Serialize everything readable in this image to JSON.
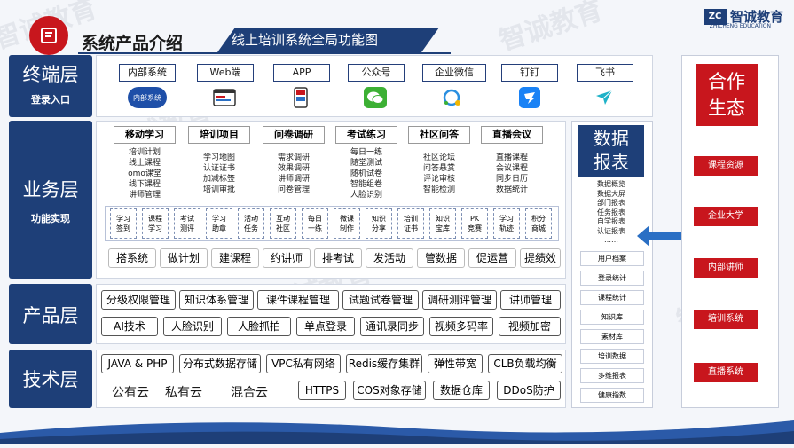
{
  "header": {
    "title": "系统产品介绍",
    "subtitle": "线上培训系统全局功能图"
  },
  "brand": {
    "name": "智诚教育",
    "en": "ZHICHENG EDUCATION",
    "mark": "ZC"
  },
  "watermark": "智诚教育",
  "layers": [
    {
      "name": "终端层",
      "sub": "登录入口"
    },
    {
      "name": "业务层",
      "sub": "功能实现"
    },
    {
      "name": "产品层",
      "sub": ""
    },
    {
      "name": "技术层",
      "sub": ""
    }
  ],
  "terminal": {
    "items": [
      {
        "label": "内部系统",
        "icon_text": "内部系统"
      },
      {
        "label": "Web端"
      },
      {
        "label": "APP"
      },
      {
        "label": "公众号"
      },
      {
        "label": "企业微信"
      },
      {
        "label": "钉钉"
      },
      {
        "label": "飞书"
      }
    ]
  },
  "business": {
    "columns": [
      {
        "title": "移动学习",
        "items": [
          "培训计划",
          "线上课程",
          "omo课堂",
          "线下课程",
          "讲师管理"
        ]
      },
      {
        "title": "培训项目",
        "items": [
          "学习地图",
          "认证证书",
          "加减标签",
          "培训审批"
        ]
      },
      {
        "title": "问卷调研",
        "items": [
          "需求调研",
          "效果调研",
          "讲师调研",
          "问卷管理"
        ]
      },
      {
        "title": "考试练习",
        "items": [
          "每日一练",
          "随堂测试",
          "随机试卷",
          "智能组卷",
          "人脸识别"
        ]
      },
      {
        "title": "社区问答",
        "items": [
          "社区论坛",
          "问答悬赏",
          "评论审核",
          "智能检测"
        ]
      },
      {
        "title": "直播会议",
        "items": [
          "直播课程",
          "会议课程",
          "同步日历",
          "数据统计"
        ]
      }
    ],
    "minis": [
      [
        "学习",
        "签到"
      ],
      [
        "课程",
        "学习"
      ],
      [
        "考试",
        "测评"
      ],
      [
        "学习",
        "助章"
      ],
      [
        "活动",
        "任务"
      ],
      [
        "互动",
        "社区"
      ],
      [
        "每日",
        "一练"
      ],
      [
        "微课",
        "制作"
      ],
      [
        "知识",
        "分享"
      ],
      [
        "培训",
        "证书"
      ],
      [
        "知识",
        "宝库"
      ],
      [
        "PK",
        "竞赛"
      ],
      [
        "学习",
        "轨迹"
      ],
      [
        "积分",
        "商城"
      ]
    ],
    "actions": [
      "搭系统",
      "做计划",
      "建课程",
      "约讲师",
      "排考试",
      "发活动",
      "管数据",
      "促运营",
      "提绩效"
    ]
  },
  "product": {
    "row1": [
      "分级权限管理",
      "知识体系管理",
      "课件课程管理",
      "试题试卷管理",
      "调研测评管理",
      "讲师管理"
    ],
    "row2": [
      "AI技术",
      "人脸识别",
      "人脸抓拍",
      "单点登录",
      "通讯录同步",
      "视频多码率",
      "视频加密"
    ]
  },
  "tech": {
    "row1": [
      "JAVA & PHP",
      "分布式数据存储",
      "VPC私有网络",
      "Redis缓存集群",
      "弹性带宽",
      "CLB负载均衡"
    ],
    "clouds": [
      "公有云",
      "私有云",
      "混合云"
    ],
    "row2": [
      "HTTPS",
      "COS对象存储",
      "数据仓库",
      "DDoS防护"
    ]
  },
  "data_report": {
    "title_1": "数据",
    "title_2": "报表",
    "list": [
      "数据概览",
      "数据大屏",
      "部门报表",
      "任务报表",
      "自学报表",
      "认证报表",
      "……"
    ],
    "items": [
      "用户档案",
      "登录统计",
      "课程统计",
      "知识库",
      "素材库",
      "培训数据",
      "多维报表",
      "健康指数"
    ]
  },
  "cooperation": {
    "title_1": "合作",
    "title_2": "生态",
    "items": [
      "课程资源",
      "企业大学",
      "内部讲师",
      "培训系统",
      "直播系统"
    ]
  },
  "colors": {
    "navy": "#1e3f78",
    "red": "#c8161d",
    "arrow": "#2a6fc4"
  }
}
